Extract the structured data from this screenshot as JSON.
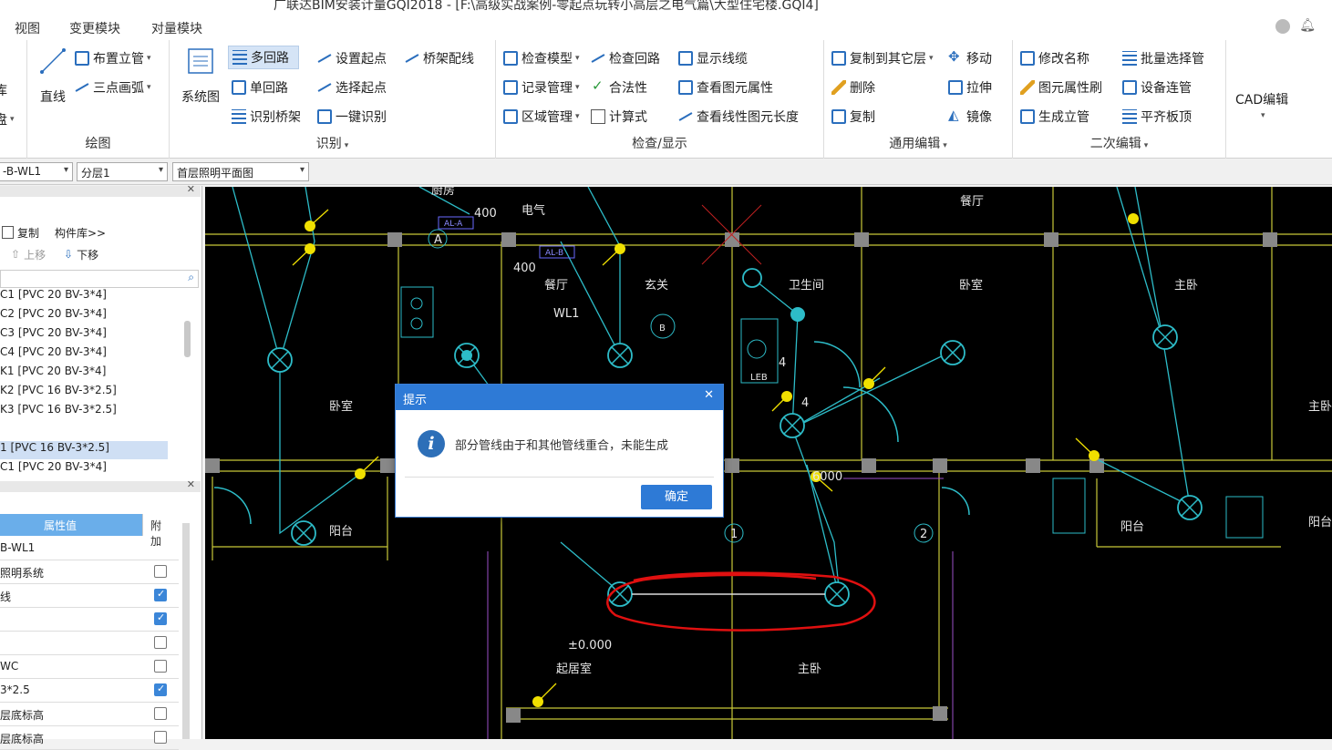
{
  "window": {
    "title": "广联达BIM安装计量GQI2018 - [F:\\高级实战案例-零起点玩转小高层之电气篇\\大型住宅楼.GQI4]"
  },
  "menu": {
    "items": [
      "视图",
      "变更模块",
      "对量模块"
    ]
  },
  "ribbon": {
    "draw": {
      "label": "绘图",
      "line": "直线",
      "place_riser": "布置立管",
      "three_point_arc": "三点画弧",
      "left_cut_1": "库",
      "left_cut_2": "盘"
    },
    "identify": {
      "label": "识别",
      "system_diagram": "系统图",
      "multi_loop": "多回路",
      "single_loop": "单回路",
      "identify_tray": "识别桥架",
      "set_start": "设置起点",
      "select_start": "选择起点",
      "one_click": "一键识别",
      "tray_wiring": "桥架配线"
    },
    "check": {
      "label": "检查/显示",
      "check_model": "检查模型",
      "record_mgmt": "记录管理",
      "area_mgmt": "区域管理",
      "check_loop": "检查回路",
      "validity": "合法性",
      "formula": "计算式",
      "show_line": "显示线缆",
      "view_props": "查看图元属性",
      "view_length": "查看线性图元长度"
    },
    "edit": {
      "label": "通用编辑",
      "copy_to_floor": "复制到其它层",
      "delete": "删除",
      "copy": "复制",
      "move": "移动",
      "stretch": "拉伸",
      "mirror": "镜像"
    },
    "secondary": {
      "label": "二次编辑",
      "rename": "修改名称",
      "attr_brush": "图元属性刷",
      "gen_riser": "生成立管",
      "batch_select": "批量选择管",
      "device_connect": "设备连管",
      "flush_top": "平齐板顶"
    },
    "cad": {
      "label": "CAD编辑"
    }
  },
  "toolbar": {
    "loop_combo": "-B-WL1",
    "layer_combo": "分层1",
    "drawing_combo": "首层照明平面图"
  },
  "left_panel": {
    "copy": "复制",
    "library": "构件库>>",
    "move_up": "上移",
    "move_down": "下移",
    "items": [
      "C1 [PVC 20 BV-3*4]",
      "C2 [PVC 20 BV-3*4]",
      "C3 [PVC 20 BV-3*4]",
      "C4 [PVC 20 BV-3*4]",
      "K1 [PVC 20 BV-3*4]",
      "K2 [PVC 16 BV-3*2.5]",
      "K3 [PVC 16 BV-3*2.5]",
      "",
      "1 [PVC 16 BV-3*2.5]",
      "C1 [PVC 20 BV-3*4]"
    ],
    "selected_index": 8,
    "prop_header": "属性值",
    "extra_header": "附加",
    "props": [
      {
        "value": "B-WL1",
        "check": null
      },
      {
        "value": "照明系统",
        "check": false
      },
      {
        "value": "线",
        "check": true
      },
      {
        "value": "",
        "check": true
      },
      {
        "value": "",
        "check": false
      },
      {
        "value": "WC",
        "check": false
      },
      {
        "value": "3*2.5",
        "check": true
      },
      {
        "value": "层底标高",
        "check": false
      },
      {
        "value": "层底标高",
        "check": false
      }
    ]
  },
  "cad_labels": {
    "kitchen": "厨房",
    "elec": "电气",
    "dining": "餐厅",
    "entry": "玄关",
    "bath": "卫生间",
    "bedroom": "卧室",
    "dining2": "餐厅",
    "master": "主卧",
    "master2": "主卧",
    "balcony": "阳台",
    "balcony2": "阳台",
    "balcony3": "阳台",
    "bedroom2": "卧室",
    "living": "起居室",
    "alA": "AL-A",
    "alB": "AL-B",
    "wl1": "WL1",
    "d400a": "400",
    "d400b": "400",
    "leb": "LEB",
    "n4a": "4",
    "n4b": "4",
    "elev": "±0.000",
    "d6000": "6000",
    "axis_a": "A",
    "axis_b": "B",
    "axis_1": "1",
    "axis_2": "2"
  },
  "dialog": {
    "title": "提示",
    "close": "✕",
    "message": "部分管线由于和其他管线重合，未能生成",
    "ok": "确定"
  }
}
